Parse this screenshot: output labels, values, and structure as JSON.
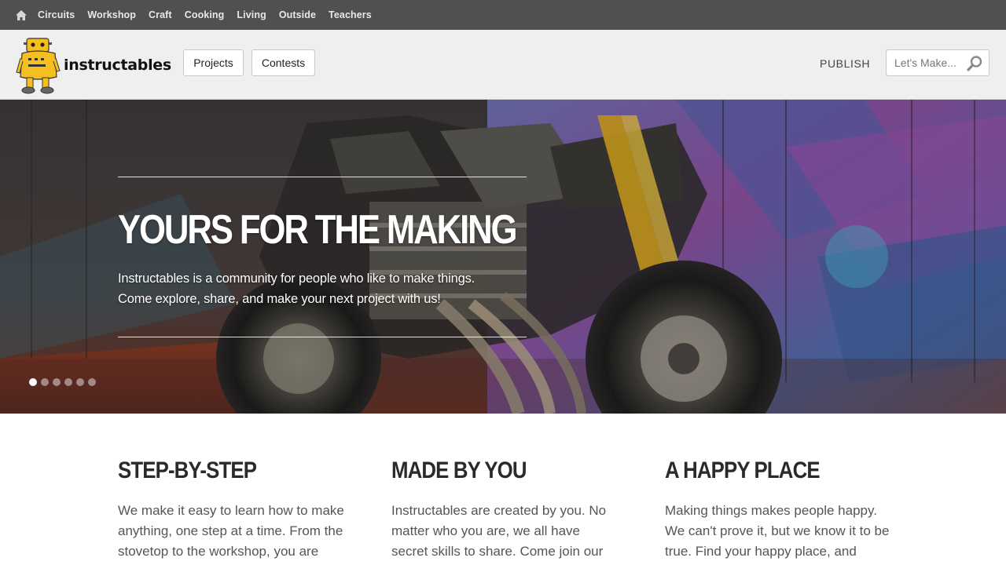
{
  "topnav": {
    "home_icon": "home-icon",
    "categories": [
      "Circuits",
      "Workshop",
      "Craft",
      "Cooking",
      "Living",
      "Outside",
      "Teachers"
    ]
  },
  "header": {
    "logo_text": "instructables",
    "projects_label": "Projects",
    "contests_label": "Contests",
    "publish_label": "PUBLISH",
    "search_placeholder": "Let's Make...",
    "search_icon": "magnifier-icon"
  },
  "hero": {
    "title": "YOURS FOR THE MAKING",
    "tagline_line1": "Instructables is a community for people who like to make things.",
    "tagline_line2": "Come explore, share, and make your next project with us!",
    "slide_count": 6,
    "active_slide": 1
  },
  "features": [
    {
      "title": "STEP-BY-STEP",
      "text": "We make it easy to learn how to make anything, one step at a time. From the stovetop to the workshop, you are"
    },
    {
      "title": "MADE BY YOU",
      "text": "Instructables are created by you. No matter who you are, we all have secret skills to share. Come join our"
    },
    {
      "title": "A HAPPY PLACE",
      "text": "Making things makes people happy. We can't prove it, but we know it to be true. Find your happy place, and"
    }
  ],
  "colors": {
    "topbar_bg": "#505050",
    "header_bg": "#efefef",
    "robot_yellow": "#f5c01f"
  }
}
